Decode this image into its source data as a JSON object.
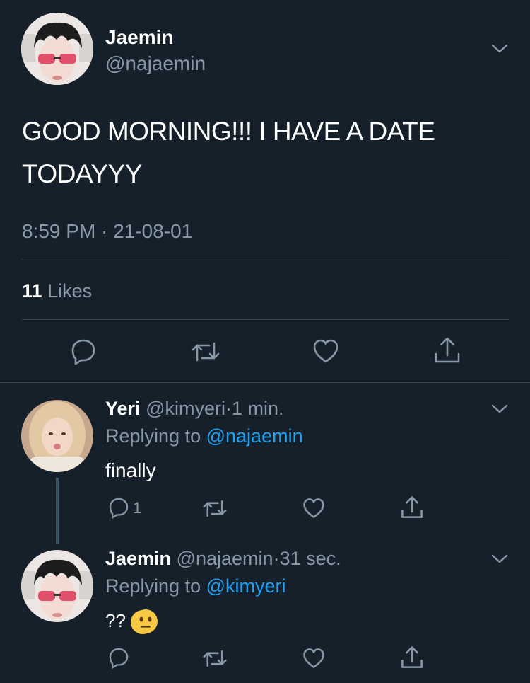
{
  "main_tweet": {
    "author_name": "Jaemin",
    "author_handle": "@najaemin",
    "text": "GOOD MORNING!!! I HAVE A DATE TODAYYY",
    "timestamp": "8:59 PM · 21-08-01",
    "likes_count": "11",
    "likes_label": "Likes"
  },
  "replies": [
    {
      "author_name": "Yeri",
      "author_handle": "@kimyeri",
      "separator": "·",
      "time": "1 min.",
      "replying_prefix": "Replying to",
      "replying_to": "@najaemin",
      "text": "finally",
      "reply_count": "1"
    },
    {
      "author_name": "Jaemin",
      "author_handle": "@najaemin",
      "separator": "·",
      "time": "31 sec.",
      "replying_prefix": "Replying to",
      "replying_to": "@kimyeri",
      "text": "??",
      "emoji": "😐"
    }
  ],
  "colors": {
    "background": "#15202b",
    "muted": "#8899a6",
    "link": "#1da1f2",
    "divider": "#38444d"
  },
  "icons": {
    "reply": "reply-icon",
    "retweet": "retweet-icon",
    "like": "heart-icon",
    "share": "share-icon",
    "more": "chevron-down-icon"
  }
}
